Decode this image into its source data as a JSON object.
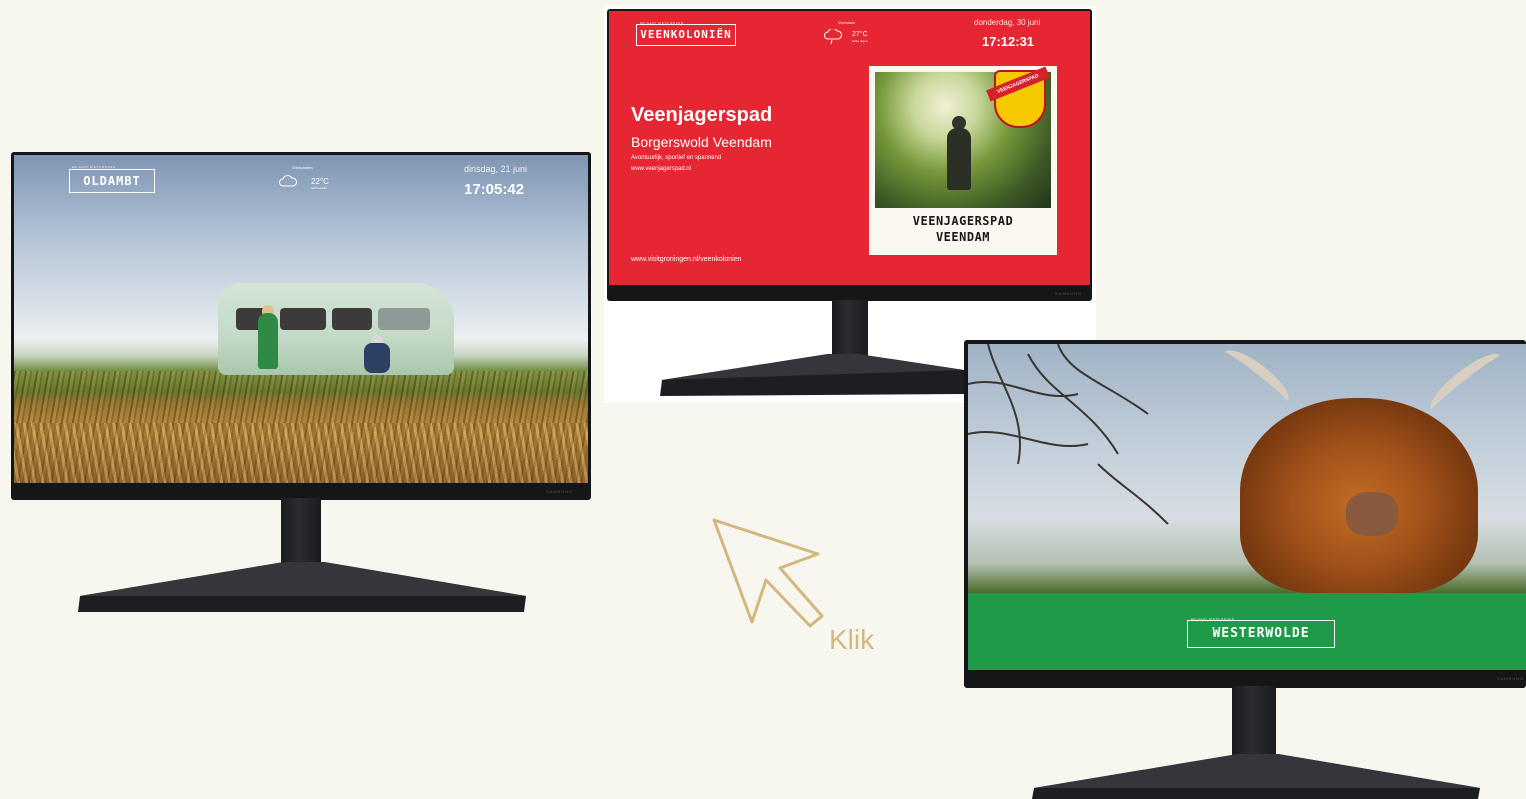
{
  "colors": {
    "background": "#f8f7ef",
    "veenkolonien_red": "#e62632",
    "westerwolde_green": "#1e9a48",
    "cursor_gold": "#d4b77e"
  },
  "monitor_oldambt": {
    "region_tag": "ER GAAT NIETS BOVEN",
    "logo": "OLDAMBT",
    "weather_place": "Winschoten",
    "temperature": "22°C",
    "weather_note": "half bewolkt",
    "weather_icon": "cloud-icon",
    "date": "dinsdag, 21 juni",
    "time": "17:05:42",
    "brand": "SAMSUNG"
  },
  "monitor_veenkolonien": {
    "region_tag": "ER GAAT NIETS BOVEN",
    "logo": "VEENKOLONIËN",
    "weather_place": "Veendam",
    "temperature": "27°C",
    "weather_note": "lichte regen",
    "weather_icon": "rain-cloud-icon",
    "date": "donderdag, 30 juni",
    "time": "17:12:31",
    "title": "Veenjagerspad",
    "subtitle": "Borgerswold Veendam",
    "line1": "Avontuurlijk, sportief en spannend",
    "line2": "www.veenjagerspad.nl",
    "footer_url": "www.visitgroningen.nl/veenkolonien",
    "badge_text": "VEENJAGERSPAD",
    "card_line1": "VEENJAGERSPAD",
    "card_line2": "VEENDAM",
    "brand": "SAMSUNG"
  },
  "monitor_westerwolde": {
    "region_tag": "ER GAAT NIETS BOVEN",
    "logo": "WESTERWOLDE",
    "brand": "SAMSUNG"
  },
  "cursor": {
    "icon": "cursor-arrow-icon",
    "label": "Klik"
  }
}
